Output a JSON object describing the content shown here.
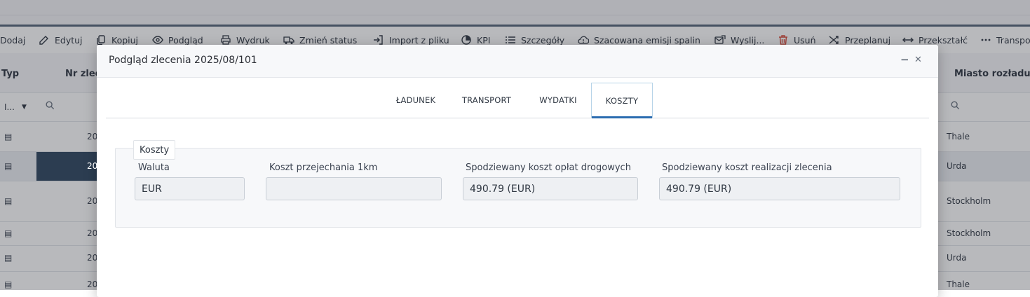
{
  "toolbar": {
    "items": [
      {
        "label": "Dodaj",
        "icon": "plus-icon"
      },
      {
        "label": "Edytuj",
        "icon": "edit-icon"
      },
      {
        "label": "Kopiuj",
        "icon": "copy-icon"
      },
      {
        "label": "Podgląd",
        "icon": "eye-icon"
      },
      {
        "label": "Wydruk",
        "icon": "printer-icon"
      },
      {
        "label": "Zmień status",
        "icon": "truck-icon"
      },
      {
        "label": "Import z pliku",
        "icon": "import-icon"
      },
      {
        "label": "KPI",
        "icon": "pie-chart-icon"
      },
      {
        "label": "Szczegóły",
        "icon": "list-icon"
      },
      {
        "label": "Szacowana emisji spalin",
        "icon": "cloud-alert-icon"
      },
      {
        "label": "Wyslij...",
        "icon": "send-icon"
      },
      {
        "label": "Usuń",
        "icon": "trash-icon"
      },
      {
        "label": "Przeplanuj",
        "icon": "shuffle-icon"
      },
      {
        "label": "Przekształć",
        "icon": "arrows-horizontal-icon"
      },
      {
        "label": "Transpo",
        "icon": "more-icon"
      }
    ]
  },
  "grid": {
    "headers": {
      "typ": "Typ",
      "nr": "Nr zlece",
      "miasto": "Miasto rozładunku"
    },
    "filter": {
      "type_value": "I..."
    },
    "rows": [
      {
        "nr": "20",
        "city": "Thale"
      },
      {
        "nr": "20",
        "city": "Urda"
      },
      {
        "nr": "20",
        "city": "Stockholm"
      },
      {
        "nr": "20",
        "city": "Stockholm"
      },
      {
        "nr": "20",
        "city": "Urda"
      },
      {
        "nr": "20",
        "city": "Thale"
      }
    ]
  },
  "modal": {
    "title": "Podgląd zlecenia 2025/08/101",
    "minimize": "−",
    "close": "✕",
    "tabs": [
      "ŁADUNEK",
      "TRANSPORT",
      "WYDATKI",
      "KOSZTY"
    ],
    "active_tab": "KOSZTY",
    "section": {
      "legend": "Koszty",
      "fields": [
        {
          "label": "Waluta",
          "value": "EUR"
        },
        {
          "label": "Koszt przejechania 1km",
          "value": ""
        },
        {
          "label": "Spodziewany koszt opłat drogowych",
          "value": "490.79 (EUR)"
        },
        {
          "label": "Spodziewany koszt realizacji zlecenia",
          "value": "490.79 (EUR)"
        }
      ]
    }
  },
  "colors": {
    "toolbar_border": "#54657a",
    "active_tab_underline": "#2b6cb0",
    "selected_cell": "#2f4660",
    "delete_icon": "#d84a3a"
  }
}
